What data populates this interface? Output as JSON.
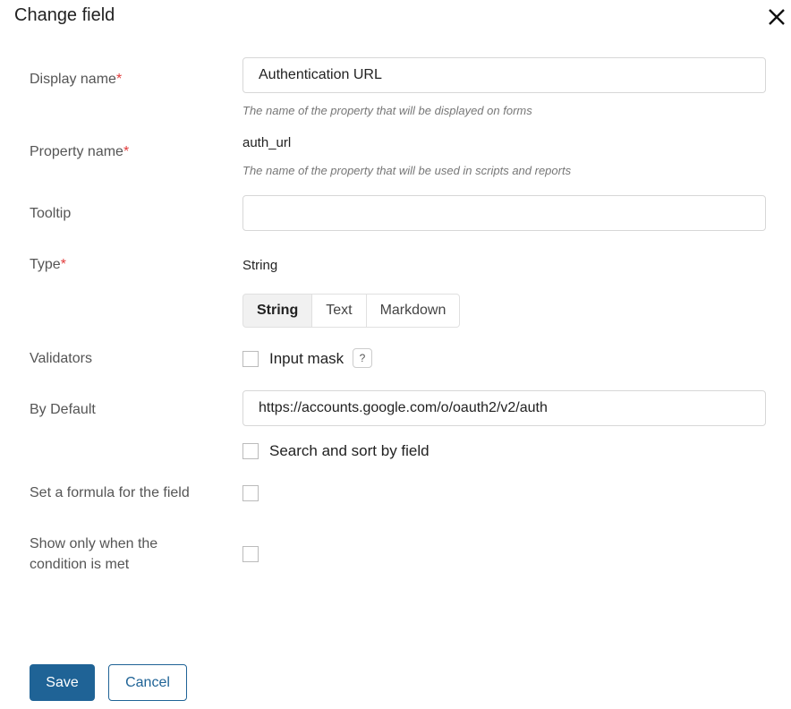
{
  "dialog": {
    "title": "Change field"
  },
  "fields": {
    "display_name": {
      "label": "Display name",
      "required_mark": "*",
      "value": "Authentication URL",
      "hint": "The name of the property that will be displayed on forms"
    },
    "property_name": {
      "label": "Property name",
      "required_mark": "*",
      "value": "auth_url",
      "hint": "The name of the property that will be used in scripts and reports"
    },
    "tooltip": {
      "label": "Tooltip",
      "value": ""
    },
    "type": {
      "label": "Type",
      "required_mark": "*",
      "value": "String",
      "options": [
        "String",
        "Text",
        "Markdown"
      ],
      "selected": "String"
    },
    "validators": {
      "label": "Validators",
      "input_mask_label": "Input mask",
      "input_mask_checked": false,
      "help_icon": "?"
    },
    "by_default": {
      "label": "By Default",
      "value": "https://accounts.google.com/o/oauth2/v2/auth",
      "search_sort_label": "Search and sort by field",
      "search_sort_checked": false
    },
    "formula": {
      "label": "Set a formula for the field",
      "checked": false
    },
    "condition": {
      "label_line1": "Show only when the",
      "label_line2": "condition is met",
      "checked": false
    }
  },
  "buttons": {
    "save": "Save",
    "cancel": "Cancel"
  },
  "colors": {
    "primary": "#1f6396",
    "required": "#e23b3b"
  }
}
